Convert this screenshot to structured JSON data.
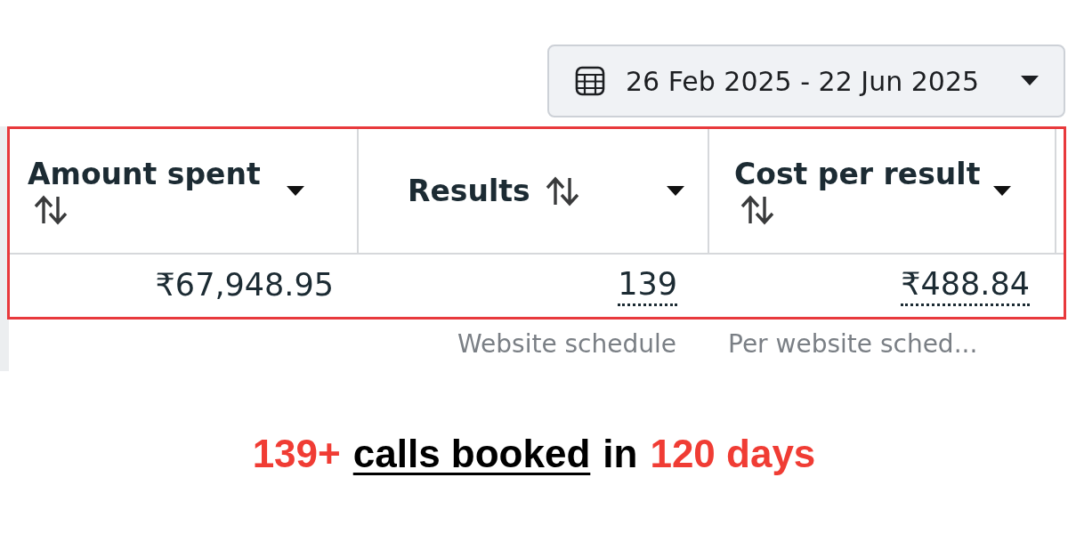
{
  "date_range": {
    "label": "26 Feb 2025 - 22 Jun 2025"
  },
  "table": {
    "columns": [
      {
        "title": "Amount spent"
      },
      {
        "title": "Results"
      },
      {
        "title": "Cost per result"
      }
    ],
    "row": [
      {
        "value": "₹67,948.95",
        "underlined": false
      },
      {
        "value": "139",
        "underlined": true,
        "caption": "Website schedule"
      },
      {
        "value": "₹488.84",
        "underlined": true,
        "caption": "Per website sched..."
      }
    ]
  },
  "headline": [
    {
      "text": "139+",
      "kind": "highlight"
    },
    {
      "text": "calls booked",
      "kind": "underline"
    },
    {
      "text": "in",
      "kind": "plain"
    },
    {
      "text": "120 days",
      "kind": "highlight"
    }
  ]
}
